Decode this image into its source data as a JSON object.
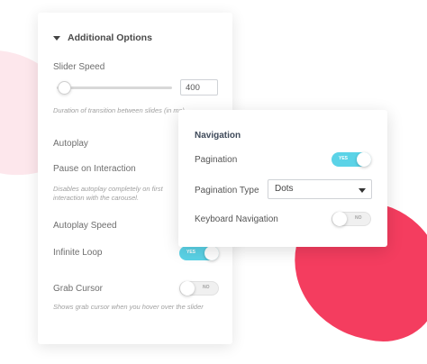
{
  "options": {
    "title": "Additional Options",
    "slider_speed": {
      "label": "Slider Speed",
      "value": "400",
      "hint": "Duration of transition between slides (in ms)"
    },
    "autoplay": {
      "label": "Autoplay"
    },
    "pause_on_interaction": {
      "label": "Pause on Interaction",
      "hint": "Disables autoplay completely on first interaction with the carousel."
    },
    "autoplay_speed": {
      "label": "Autoplay Speed"
    },
    "infinite_loop": {
      "label": "Infinite Loop",
      "state": "YES"
    },
    "grab_cursor": {
      "label": "Grab Cursor",
      "state": "NO",
      "hint": "Shows grab cursor when you hover over the slider"
    }
  },
  "navigation": {
    "title": "Navigation",
    "pagination": {
      "label": "Pagination",
      "state": "YES"
    },
    "pagination_type": {
      "label": "Pagination Type",
      "value": "Dots"
    },
    "keyboard_navigation": {
      "label": "Keyboard Navigation",
      "state": "NO"
    }
  },
  "colors": {
    "accent": "#5bd3e7",
    "blob_red": "#f43d5f",
    "blob_pink": "#fde7ec"
  }
}
